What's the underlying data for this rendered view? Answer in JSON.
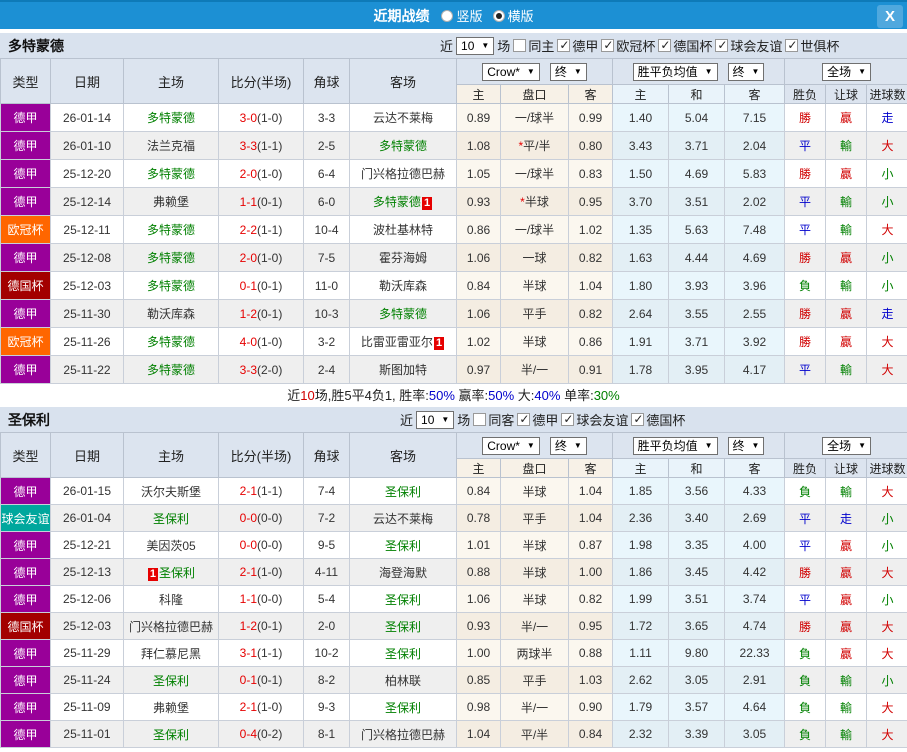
{
  "topbar": {
    "title": "近期战绩",
    "radio_options": [
      {
        "label": "竖版",
        "checked": false
      },
      {
        "label": "横版",
        "checked": true
      }
    ],
    "close_label": "X"
  },
  "columns": {
    "type": "类型",
    "date": "日期",
    "home": "主场",
    "score": "比分(半场)",
    "corner": "角球",
    "away": "客场",
    "sub": [
      "主",
      "盘口",
      "客",
      "主",
      "和",
      "客",
      "胜负",
      "让球",
      "进球数"
    ],
    "dd_crow": "Crow*",
    "dd_final": "终",
    "dd_avg": "胜平负均值",
    "dd_full": "全场"
  },
  "type_colors": {
    "德甲": "#990099",
    "欧冠杯": "#FF6600",
    "德国杯": "#A30000",
    "球会友谊": "#00A79D"
  },
  "result_colors": {
    "r": "#D10000",
    "b": "#0000CC",
    "g": "#008000",
    "k": "#222222"
  },
  "accent": {
    "topbar_blue": "#1C90D4",
    "header_bg": "#D9E2EE",
    "score_red": "#E60000",
    "team_green": "#008000"
  },
  "sections": [
    {
      "team": "多特蒙德",
      "filter": {
        "near": "近",
        "count": "10",
        "games": "场",
        "same": {
          "label": "同主",
          "checked": false
        },
        "leagues": [
          {
            "label": "德甲",
            "checked": true
          },
          {
            "label": "欧冠杯",
            "checked": true
          },
          {
            "label": "德国杯",
            "checked": true
          },
          {
            "label": "球会友谊",
            "checked": true
          },
          {
            "label": "世俱杯",
            "checked": true
          }
        ]
      },
      "rows": [
        {
          "type": "德甲",
          "date": "26-01-14",
          "home": {
            "name": "多特蒙德",
            "green": true
          },
          "score": "3-0",
          "half": "(1-0)",
          "corner": "3-3",
          "away": {
            "name": "云达不莱梅"
          },
          "crow": [
            "0.89",
            "一/球半",
            "0.99"
          ],
          "star": false,
          "avg": [
            "1.40",
            "5.04",
            "7.15"
          ],
          "res": [
            [
              "勝",
              "r"
            ],
            [
              "贏",
              "r"
            ],
            [
              "走",
              "b"
            ]
          ]
        },
        {
          "type": "德甲",
          "date": "26-01-10",
          "home": {
            "name": "法兰克福"
          },
          "score": "3-3",
          "half": "(1-1)",
          "corner": "2-5",
          "away": {
            "name": "多特蒙德",
            "green": true
          },
          "crow": [
            "1.08",
            "平/半",
            "0.80"
          ],
          "star": true,
          "avg": [
            "3.43",
            "3.71",
            "2.04"
          ],
          "res": [
            [
              "平",
              "b"
            ],
            [
              "輸",
              "g"
            ],
            [
              "大",
              "r"
            ]
          ]
        },
        {
          "type": "德甲",
          "date": "25-12-20",
          "home": {
            "name": "多特蒙德",
            "green": true
          },
          "score": "2-0",
          "half": "(1-0)",
          "corner": "6-4",
          "away": {
            "name": "门兴格拉德巴赫"
          },
          "crow": [
            "1.05",
            "一/球半",
            "0.83"
          ],
          "star": false,
          "avg": [
            "1.50",
            "4.69",
            "5.83"
          ],
          "res": [
            [
              "勝",
              "r"
            ],
            [
              "贏",
              "r"
            ],
            [
              "小",
              "g"
            ]
          ]
        },
        {
          "type": "德甲",
          "date": "25-12-14",
          "home": {
            "name": "弗赖堡"
          },
          "score": "1-1",
          "half": "(0-1)",
          "corner": "6-0",
          "away": {
            "name": "多特蒙德",
            "green": true,
            "badge": "1",
            "badge_pos": "after"
          },
          "crow": [
            "0.93",
            "半球",
            "0.95"
          ],
          "star": true,
          "avg": [
            "3.70",
            "3.51",
            "2.02"
          ],
          "res": [
            [
              "平",
              "b"
            ],
            [
              "輸",
              "g"
            ],
            [
              "小",
              "g"
            ]
          ]
        },
        {
          "type": "欧冠杯",
          "date": "25-12-11",
          "home": {
            "name": "多特蒙德",
            "green": true
          },
          "score": "2-2",
          "half": "(1-1)",
          "corner": "10-4",
          "away": {
            "name": "波杜基林特"
          },
          "crow": [
            "0.86",
            "一/球半",
            "1.02"
          ],
          "star": false,
          "avg": [
            "1.35",
            "5.63",
            "7.48"
          ],
          "res": [
            [
              "平",
              "b"
            ],
            [
              "輸",
              "g"
            ],
            [
              "大",
              "r"
            ]
          ]
        },
        {
          "type": "德甲",
          "date": "25-12-08",
          "home": {
            "name": "多特蒙德",
            "green": true
          },
          "score": "2-0",
          "half": "(1-0)",
          "corner": "7-5",
          "away": {
            "name": "霍芬海姆"
          },
          "crow": [
            "1.06",
            "一球",
            "0.82"
          ],
          "star": false,
          "avg": [
            "1.63",
            "4.44",
            "4.69"
          ],
          "res": [
            [
              "勝",
              "r"
            ],
            [
              "贏",
              "r"
            ],
            [
              "小",
              "g"
            ]
          ]
        },
        {
          "type": "德国杯",
          "date": "25-12-03",
          "home": {
            "name": "多特蒙德",
            "green": true
          },
          "score": "0-1",
          "half": "(0-1)",
          "corner": "11-0",
          "away": {
            "name": "勒沃库森"
          },
          "crow": [
            "0.84",
            "半球",
            "1.04"
          ],
          "star": false,
          "avg": [
            "1.80",
            "3.93",
            "3.96"
          ],
          "res": [
            [
              "負",
              "g"
            ],
            [
              "輸",
              "g"
            ],
            [
              "小",
              "g"
            ]
          ]
        },
        {
          "type": "德甲",
          "date": "25-11-30",
          "home": {
            "name": "勒沃库森"
          },
          "score": "1-2",
          "half": "(0-1)",
          "corner": "10-3",
          "away": {
            "name": "多特蒙德",
            "green": true
          },
          "crow": [
            "1.06",
            "平手",
            "0.82"
          ],
          "star": false,
          "avg": [
            "2.64",
            "3.55",
            "2.55"
          ],
          "res": [
            [
              "勝",
              "r"
            ],
            [
              "贏",
              "r"
            ],
            [
              "走",
              "b"
            ]
          ]
        },
        {
          "type": "欧冠杯",
          "date": "25-11-26",
          "home": {
            "name": "多特蒙德",
            "green": true
          },
          "score": "4-0",
          "half": "(1-0)",
          "corner": "3-2",
          "away": {
            "name": "比雷亚雷亚尔",
            "badge": "1",
            "badge_pos": "after"
          },
          "crow": [
            "1.02",
            "半球",
            "0.86"
          ],
          "star": false,
          "avg": [
            "1.91",
            "3.71",
            "3.92"
          ],
          "res": [
            [
              "勝",
              "r"
            ],
            [
              "贏",
              "r"
            ],
            [
              "大",
              "r"
            ]
          ]
        },
        {
          "type": "德甲",
          "date": "25-11-22",
          "home": {
            "name": "多特蒙德",
            "green": true
          },
          "score": "3-3",
          "half": "(2-0)",
          "corner": "2-4",
          "away": {
            "name": "斯图加特"
          },
          "crow": [
            "0.97",
            "半/一",
            "0.91"
          ],
          "star": false,
          "avg": [
            "1.78",
            "3.95",
            "4.17"
          ],
          "res": [
            [
              "平",
              "b"
            ],
            [
              "輸",
              "g"
            ],
            [
              "大",
              "r"
            ]
          ]
        }
      ],
      "summary": [
        {
          "t": "近",
          "c": "k"
        },
        {
          "t": "10",
          "c": "r"
        },
        {
          "t": "场,胜5平4负1, 胜率:",
          "c": "k"
        },
        {
          "t": "50%",
          "c": "b"
        },
        {
          "t": " 赢率:",
          "c": "k"
        },
        {
          "t": "50%",
          "c": "b"
        },
        {
          "t": " 大:",
          "c": "k"
        },
        {
          "t": "40%",
          "c": "b"
        },
        {
          "t": " 单率:",
          "c": "k"
        },
        {
          "t": "30%",
          "c": "g"
        }
      ]
    },
    {
      "team": "圣保利",
      "filter": {
        "near": "近",
        "count": "10",
        "games": "场",
        "same": {
          "label": "同客",
          "checked": false
        },
        "leagues": [
          {
            "label": "德甲",
            "checked": true
          },
          {
            "label": "球会友谊",
            "checked": true
          },
          {
            "label": "德国杯",
            "checked": true
          }
        ]
      },
      "rows": [
        {
          "type": "德甲",
          "date": "26-01-15",
          "home": {
            "name": "沃尔夫斯堡"
          },
          "score": "2-1",
          "half": "(1-1)",
          "corner": "7-4",
          "away": {
            "name": "圣保利",
            "green": true
          },
          "crow": [
            "0.84",
            "半球",
            "1.04"
          ],
          "star": false,
          "avg": [
            "1.85",
            "3.56",
            "4.33"
          ],
          "res": [
            [
              "負",
              "g"
            ],
            [
              "輸",
              "g"
            ],
            [
              "大",
              "r"
            ]
          ]
        },
        {
          "type": "球会友谊",
          "date": "26-01-04",
          "home": {
            "name": "圣保利",
            "green": true
          },
          "score": "0-0",
          "half": "(0-0)",
          "corner": "7-2",
          "away": {
            "name": "云达不莱梅"
          },
          "crow": [
            "0.78",
            "平手",
            "1.04"
          ],
          "star": false,
          "avg": [
            "2.36",
            "3.40",
            "2.69"
          ],
          "res": [
            [
              "平",
              "b"
            ],
            [
              "走",
              "b"
            ],
            [
              "小",
              "g"
            ]
          ]
        },
        {
          "type": "德甲",
          "date": "25-12-21",
          "home": {
            "name": "美因茨05"
          },
          "score": "0-0",
          "half": "(0-0)",
          "corner": "9-5",
          "away": {
            "name": "圣保利",
            "green": true
          },
          "crow": [
            "1.01",
            "半球",
            "0.87"
          ],
          "star": false,
          "avg": [
            "1.98",
            "3.35",
            "4.00"
          ],
          "res": [
            [
              "平",
              "b"
            ],
            [
              "贏",
              "r"
            ],
            [
              "小",
              "g"
            ]
          ]
        },
        {
          "type": "德甲",
          "date": "25-12-13",
          "home": {
            "name": "圣保利",
            "green": true,
            "badge": "1",
            "badge_pos": "before"
          },
          "score": "2-1",
          "half": "(1-0)",
          "corner": "4-11",
          "away": {
            "name": "海登海默"
          },
          "crow": [
            "0.88",
            "半球",
            "1.00"
          ],
          "star": false,
          "avg": [
            "1.86",
            "3.45",
            "4.42"
          ],
          "res": [
            [
              "勝",
              "r"
            ],
            [
              "贏",
              "r"
            ],
            [
              "大",
              "r"
            ]
          ]
        },
        {
          "type": "德甲",
          "date": "25-12-06",
          "home": {
            "name": "科隆"
          },
          "score": "1-1",
          "half": "(0-0)",
          "corner": "5-4",
          "away": {
            "name": "圣保利",
            "green": true
          },
          "crow": [
            "1.06",
            "半球",
            "0.82"
          ],
          "star": false,
          "avg": [
            "1.99",
            "3.51",
            "3.74"
          ],
          "res": [
            [
              "平",
              "b"
            ],
            [
              "贏",
              "r"
            ],
            [
              "小",
              "g"
            ]
          ]
        },
        {
          "type": "德国杯",
          "date": "25-12-03",
          "home": {
            "name": "门兴格拉德巴赫"
          },
          "score": "1-2",
          "half": "(0-1)",
          "corner": "2-0",
          "away": {
            "name": "圣保利",
            "green": true
          },
          "crow": [
            "0.93",
            "半/一",
            "0.95"
          ],
          "star": false,
          "avg": [
            "1.72",
            "3.65",
            "4.74"
          ],
          "res": [
            [
              "勝",
              "r"
            ],
            [
              "贏",
              "r"
            ],
            [
              "大",
              "r"
            ]
          ]
        },
        {
          "type": "德甲",
          "date": "25-11-29",
          "home": {
            "name": "拜仁慕尼黑"
          },
          "score": "3-1",
          "half": "(1-1)",
          "corner": "10-2",
          "away": {
            "name": "圣保利",
            "green": true
          },
          "crow": [
            "1.00",
            "两球半",
            "0.88"
          ],
          "star": false,
          "avg": [
            "1.11",
            "9.80",
            "22.33"
          ],
          "res": [
            [
              "負",
              "g"
            ],
            [
              "贏",
              "r"
            ],
            [
              "大",
              "r"
            ]
          ]
        },
        {
          "type": "德甲",
          "date": "25-11-24",
          "home": {
            "name": "圣保利",
            "green": true
          },
          "score": "0-1",
          "half": "(0-1)",
          "corner": "8-2",
          "away": {
            "name": "柏林联"
          },
          "crow": [
            "0.85",
            "平手",
            "1.03"
          ],
          "star": false,
          "avg": [
            "2.62",
            "3.05",
            "2.91"
          ],
          "res": [
            [
              "負",
              "g"
            ],
            [
              "輸",
              "g"
            ],
            [
              "小",
              "g"
            ]
          ]
        },
        {
          "type": "德甲",
          "date": "25-11-09",
          "home": {
            "name": "弗赖堡"
          },
          "score": "2-1",
          "half": "(1-0)",
          "corner": "9-3",
          "away": {
            "name": "圣保利",
            "green": true
          },
          "crow": [
            "0.98",
            "半/一",
            "0.90"
          ],
          "star": false,
          "avg": [
            "1.79",
            "3.57",
            "4.64"
          ],
          "res": [
            [
              "負",
              "g"
            ],
            [
              "輸",
              "g"
            ],
            [
              "大",
              "r"
            ]
          ]
        },
        {
          "type": "德甲",
          "date": "25-11-01",
          "home": {
            "name": "圣保利",
            "green": true
          },
          "score": "0-4",
          "half": "(0-2)",
          "corner": "8-1",
          "away": {
            "name": "门兴格拉德巴赫"
          },
          "crow": [
            "1.04",
            "平/半",
            "0.84"
          ],
          "star": false,
          "avg": [
            "2.32",
            "3.39",
            "3.05"
          ],
          "res": [
            [
              "負",
              "g"
            ],
            [
              "輸",
              "g"
            ],
            [
              "大",
              "r"
            ]
          ]
        }
      ],
      "summary": []
    }
  ]
}
